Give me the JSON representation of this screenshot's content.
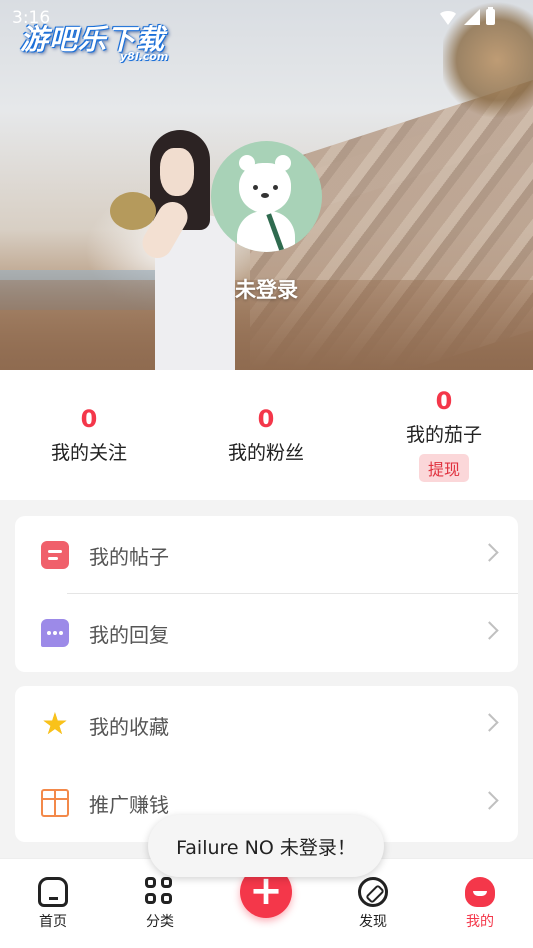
{
  "status_bar": {
    "time": "3:16"
  },
  "watermark": {
    "text": "游吧乐下载",
    "sub": "y8l.com"
  },
  "profile": {
    "name": "未登录"
  },
  "stats": [
    {
      "value": "0",
      "label": "我的关注"
    },
    {
      "value": "0",
      "label": "我的粉丝"
    },
    {
      "value": "0",
      "label": "我的茄子",
      "action": "提现"
    }
  ],
  "menu_group_1": [
    {
      "label": "我的帖子",
      "icon": "post-icon"
    },
    {
      "label": "我的回复",
      "icon": "reply-icon"
    }
  ],
  "menu_group_2": [
    {
      "label": "我的收藏",
      "icon": "star-icon"
    },
    {
      "label": "推广赚钱",
      "icon": "gift-icon"
    }
  ],
  "toast": {
    "text": "Failure NO 未登录！"
  },
  "nav": [
    {
      "label": "首页",
      "icon": "home-icon"
    },
    {
      "label": "分类",
      "icon": "grid-icon"
    },
    {
      "label": "发现",
      "icon": "compass-icon"
    },
    {
      "label": "我的",
      "icon": "profile-icon",
      "active": true
    }
  ],
  "colors": {
    "accent": "#f4374a",
    "withdraw_bg": "#fbd7d9"
  }
}
